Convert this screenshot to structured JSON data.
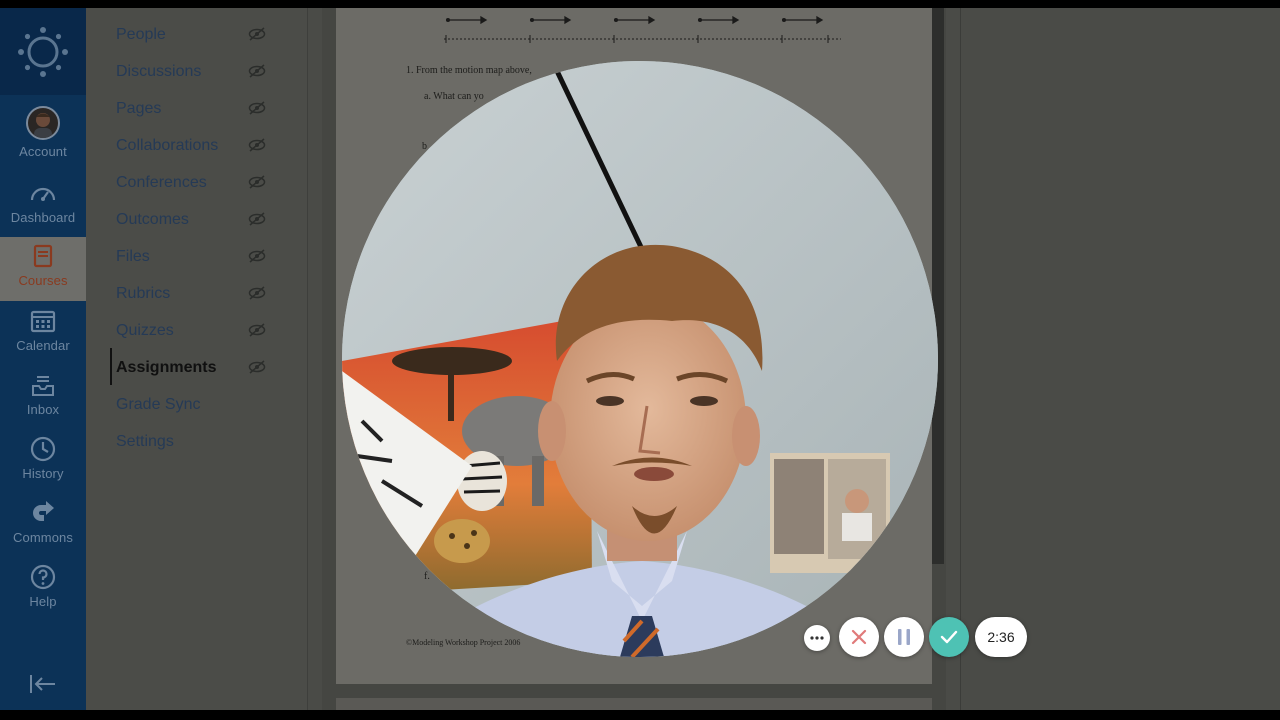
{
  "global_nav": {
    "items": [
      {
        "label": "Account",
        "icon": "account-avatar"
      },
      {
        "label": "Dashboard",
        "icon": "dashboard-icon"
      },
      {
        "label": "Courses",
        "icon": "courses-icon"
      },
      {
        "label": "Calendar",
        "icon": "calendar-icon"
      },
      {
        "label": "Inbox",
        "icon": "inbox-icon"
      },
      {
        "label": "History",
        "icon": "history-icon"
      },
      {
        "label": "Commons",
        "icon": "commons-icon"
      },
      {
        "label": "Help",
        "icon": "help-icon"
      }
    ],
    "active": "Courses"
  },
  "course_nav": {
    "items": [
      {
        "label": "People"
      },
      {
        "label": "Discussions"
      },
      {
        "label": "Pages"
      },
      {
        "label": "Collaborations"
      },
      {
        "label": "Conferences"
      },
      {
        "label": "Outcomes"
      },
      {
        "label": "Files"
      },
      {
        "label": "Rubrics"
      },
      {
        "label": "Quizzes"
      },
      {
        "label": "Assignments"
      },
      {
        "label": "Grade Sync"
      },
      {
        "label": "Settings"
      }
    ],
    "active": "Assignments"
  },
  "document": {
    "question": "1.   From the motion map above,",
    "sub_a": "a.    What can yo",
    "sub_b": "b",
    "sub_f": "f.",
    "footer": "©Modeling Workshop Project 2006"
  },
  "recorder": {
    "timer": "2:36",
    "more_icon": "more-dots-icon",
    "cancel_icon": "close-icon",
    "pause_icon": "pause-icon",
    "done_icon": "check-icon",
    "accent_color": "#4ec2b4",
    "cancel_color": "#e07a7a"
  }
}
